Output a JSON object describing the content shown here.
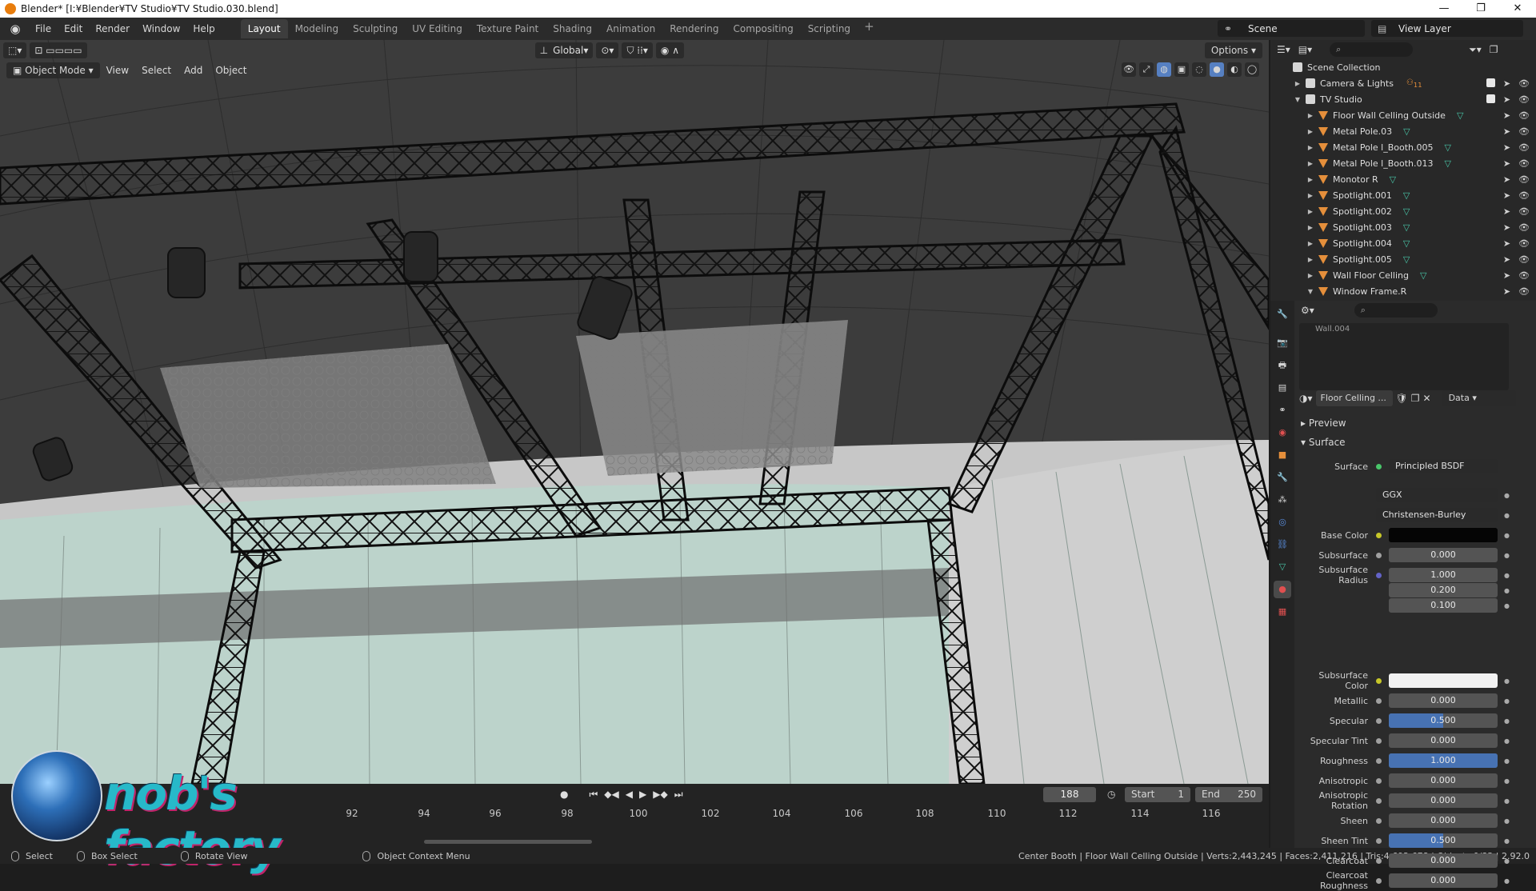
{
  "window": {
    "title": "Blender* [I:¥Blender¥TV Studio¥TV Studio.030.blend]",
    "controls": [
      "—",
      "❐",
      "✕"
    ]
  },
  "menu": {
    "items": [
      "File",
      "Edit",
      "Render",
      "Window",
      "Help"
    ],
    "workspaces": [
      "Layout",
      "Modeling",
      "Sculpting",
      "UV Editing",
      "Texture Paint",
      "Shading",
      "Animation",
      "Rendering",
      "Compositing",
      "Scripting"
    ],
    "active_workspace": "Layout",
    "add_workspace": "+",
    "scene": "Scene",
    "view_layer": "View Layer"
  },
  "viewport": {
    "mode": "Object Mode",
    "menus": [
      "View",
      "Select",
      "Add",
      "Object"
    ],
    "transform_orientation": "Global",
    "options": "Options"
  },
  "timeline": {
    "current_frame": "188",
    "start_label": "Start",
    "start_value": "1",
    "end_label": "End",
    "end_value": "250",
    "ruler": [
      "92",
      "94",
      "96",
      "98",
      "100",
      "102",
      "104",
      "106",
      "108",
      "110",
      "112",
      "114",
      "116"
    ]
  },
  "status": {
    "select": "Select",
    "box_select": "Box Select",
    "rotate_view": "Rotate View",
    "context_menu": "Object Context Menu",
    "stats": "Center Booth | Floor Wall Celling Outside | Verts:2,443,245 | Faces:2,411,216 | Tris:4,692,678 | Objects:0/83 | 2.92.0"
  },
  "outliner": {
    "root": "Scene Collection",
    "collections": [
      {
        "name": "Camera & Lights",
        "badge": "11"
      },
      {
        "name": "TV Studio"
      }
    ],
    "objects": [
      "Floor Wall Celling Outside",
      "Metal Pole.03",
      "Metal Pole l_Booth.005",
      "Metal Pole l_Booth.013",
      "Monotor R",
      "Spotlight.001",
      "Spotlight.002",
      "Spotlight.003",
      "Spotlight.004",
      "Spotlight.005",
      "Wall Floor Celling",
      "Window Frame.R"
    ]
  },
  "properties": {
    "slot_item": "Wall.004",
    "material_name": "Floor Celling ...",
    "link": "Data",
    "panels": {
      "preview": "Preview",
      "surface": "Surface"
    },
    "surface_shader_label": "Surface",
    "surface_shader": "Principled BSDF",
    "distribution": "GGX",
    "subsurface_method": "Christensen-Burley",
    "base_color_label": "Base Color",
    "base_color": "#050505",
    "subsurface_color_label": "Subsurface Color",
    "subsurface_color": "#f2f2f2",
    "fields": [
      {
        "label": "Subsurface",
        "value": "0.000",
        "fill": 0
      },
      {
        "label": "Subsurface Radius",
        "value": "1.000",
        "fill": 0
      },
      {
        "label": "",
        "value": "0.200",
        "fill": 0
      },
      {
        "label": "",
        "value": "0.100",
        "fill": 0
      },
      {
        "label": "Metallic",
        "value": "0.000",
        "fill": 0
      },
      {
        "label": "Specular",
        "value": "0.500",
        "fill": 0.5
      },
      {
        "label": "Specular Tint",
        "value": "0.000",
        "fill": 0
      },
      {
        "label": "Roughness",
        "value": "1.000",
        "fill": 1
      },
      {
        "label": "Anisotropic",
        "value": "0.000",
        "fill": 0
      },
      {
        "label": "Anisotropic Rotation",
        "value": "0.000",
        "fill": 0
      },
      {
        "label": "Sheen",
        "value": "0.000",
        "fill": 0
      },
      {
        "label": "Sheen Tint",
        "value": "0.500",
        "fill": 0.5
      },
      {
        "label": "Clearcoat",
        "value": "0.000",
        "fill": 0
      },
      {
        "label": "Clearcoat Roughness",
        "value": "0.000",
        "fill": 0
      }
    ]
  },
  "watermark": "nob's factory",
  "colors": {
    "accent": "#4772b3",
    "mesh_icon": "#49c6a8",
    "object_icon": "#e58f3b",
    "logo": "#27b9c9"
  }
}
